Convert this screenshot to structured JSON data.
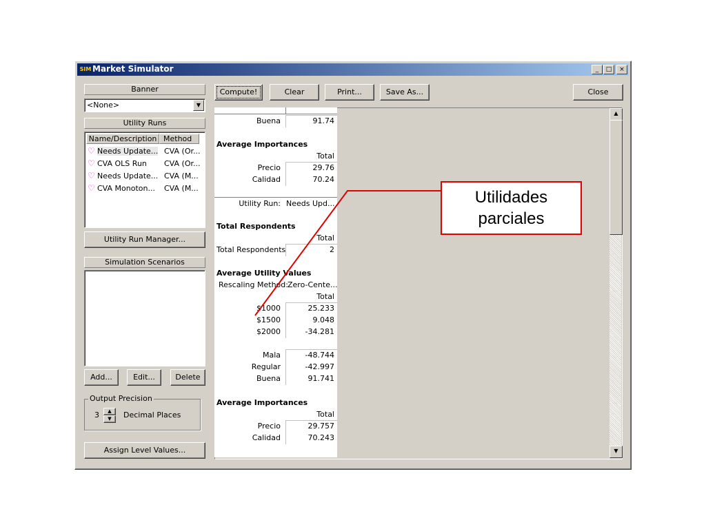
{
  "window": {
    "title": "Market Simulator",
    "icon_label": "SIM",
    "controls": {
      "minimize": "_",
      "maximize": "□",
      "close": "×"
    }
  },
  "left": {
    "banner": {
      "header": "Banner",
      "selected": "<None>"
    },
    "utility_runs": {
      "header": "Utility Runs",
      "columns": [
        "Name/Description",
        "Method"
      ],
      "rows": [
        {
          "name": "Needs Update...",
          "method": "CVA (Or..."
        },
        {
          "name": "CVA OLS Run",
          "method": "CVA (Or..."
        },
        {
          "name": "Needs Update...",
          "method": "CVA (M..."
        },
        {
          "name": "CVA Monoton...",
          "method": "CVA (M..."
        }
      ],
      "manager_button": "Utility Run Manager..."
    },
    "scenarios": {
      "header": "Simulation Scenarios",
      "add": "Add...",
      "edit": "Edit...",
      "delete": "Delete"
    },
    "precision": {
      "legend": "Output Precision",
      "value": "3",
      "label": "Decimal Places"
    },
    "assign_button": "Assign Level Values..."
  },
  "toolbar": {
    "compute": "Compute!",
    "clear": "Clear",
    "print": "Print...",
    "save_as": "Save As...",
    "close": "Close"
  },
  "report": {
    "top_row": {
      "label": "Buena",
      "value": "91.74"
    },
    "avg_imp_1": {
      "title": "Average Importances",
      "total": "Total",
      "rows": [
        {
          "label": "Precio",
          "value": "29.76"
        },
        {
          "label": "Calidad",
          "value": "70.24"
        }
      ]
    },
    "utility_run": {
      "label": "Utility Run:",
      "value": "Needs Upd..."
    },
    "total_resp": {
      "title": "Total Respondents",
      "total": "Total",
      "row": {
        "label": "Total Respondents",
        "value": "2"
      }
    },
    "avg_util": {
      "title": "Average Utility Values",
      "rescaling_label": "Rescaling Method:",
      "rescaling_value": "Zero-Cente...",
      "total": "Total",
      "group1": [
        {
          "label": "$1000",
          "value": "25.233"
        },
        {
          "label": "$1500",
          "value": "9.048"
        },
        {
          "label": "$2000",
          "value": "-34.281"
        }
      ],
      "group2": [
        {
          "label": "Mala",
          "value": "-48.744"
        },
        {
          "label": "Regular",
          "value": "-42.997"
        },
        {
          "label": "Buena",
          "value": "91.741"
        }
      ]
    },
    "avg_imp_2": {
      "title": "Average Importances",
      "total": "Total",
      "rows": [
        {
          "label": "Precio",
          "value": "29.757"
        },
        {
          "label": "Calidad",
          "value": "70.243"
        }
      ]
    }
  },
  "callout": {
    "line1": "Utilidades",
    "line2": "parciales",
    "color": "#e00000"
  }
}
